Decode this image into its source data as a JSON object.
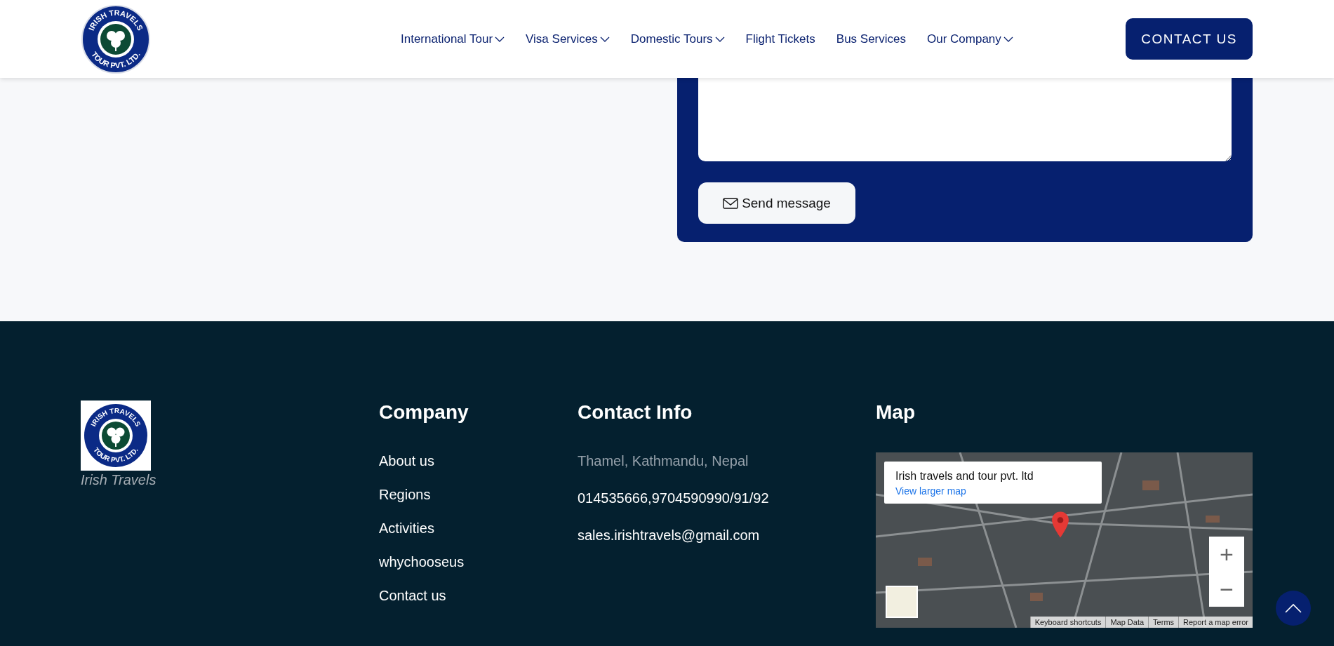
{
  "header": {
    "logo_text": [
      "IRISH TRAVELS",
      "TOUR PVT. LTD."
    ],
    "nav": [
      {
        "label": "International Tour",
        "dropdown": true
      },
      {
        "label": "Visa Services",
        "dropdown": true
      },
      {
        "label": "Domestic Tours",
        "dropdown": true
      },
      {
        "label": "Flight Tickets",
        "dropdown": false
      },
      {
        "label": "Bus Services",
        "dropdown": false
      },
      {
        "label": "Our Company",
        "dropdown": true
      }
    ],
    "cta": "CONTACT US"
  },
  "form": {
    "send_button": "Send message"
  },
  "footer": {
    "logo_text": [
      "IRISH TRAVELS",
      "TOUR PVT. LTD."
    ],
    "brand": "Irish Travels",
    "company": {
      "heading": "Company",
      "links": [
        "About us",
        "Regions",
        "Activities",
        "whychooseus",
        "Contact us"
      ]
    },
    "contact": {
      "heading": "Contact Info",
      "items": [
        {
          "text": "Thamel, Kathmandu, Nepal",
          "muted": true
        },
        {
          "text": "014535666,9704590990/91/92",
          "muted": false
        },
        {
          "text": "sales.irishtravels@gmail.com",
          "muted": false
        }
      ]
    },
    "map": {
      "heading": "Map",
      "info_title": "Irish travels and tour pvt. ltd",
      "info_link": "View larger map",
      "zoom_in": "+",
      "zoom_out": "−",
      "attributions": [
        "Keyboard shortcuts",
        "Map Data",
        "Terms",
        "Report a map error"
      ]
    }
  }
}
